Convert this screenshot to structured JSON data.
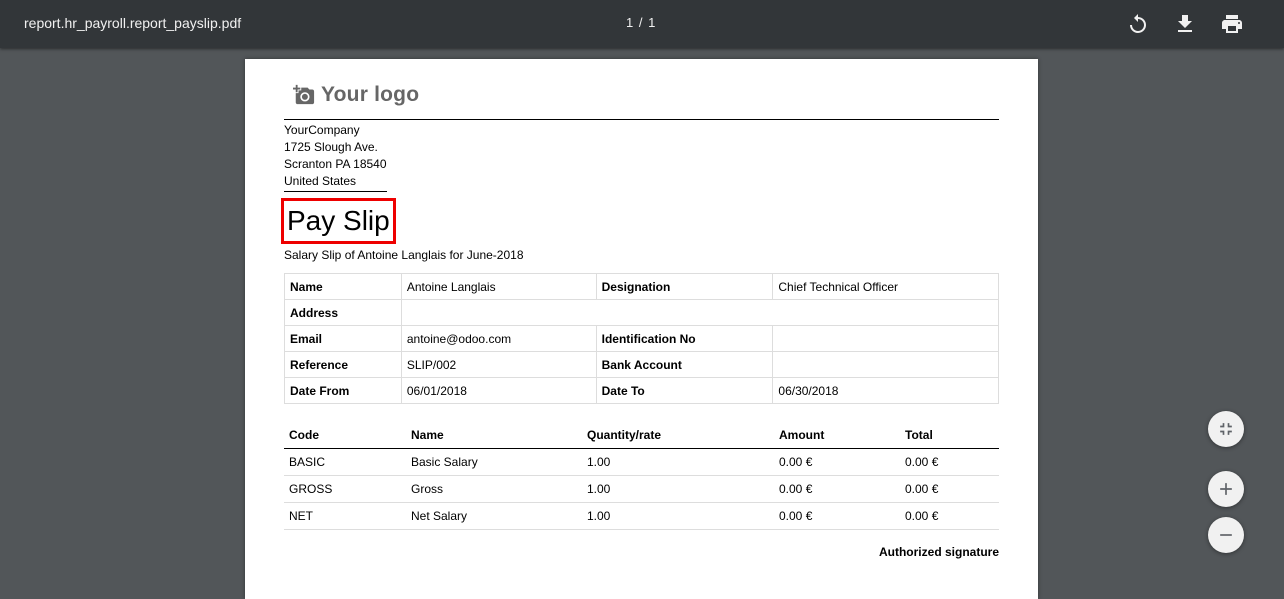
{
  "toolbar": {
    "title": "report.hr_payroll.report_payslip.pdf",
    "page_indicator": "1 / 1",
    "icons": [
      "rotate-icon",
      "download-icon",
      "print-icon"
    ]
  },
  "document": {
    "logo_text": "Your logo",
    "company": [
      "YourCompany",
      "1725 Slough Ave.",
      "Scranton PA 18540",
      "United States"
    ],
    "title": "Pay Slip",
    "subtitle": "Salary Slip of Antoine Langlais for June-2018",
    "info": {
      "name_label": "Name",
      "name_value": "Antoine Langlais",
      "designation_label": "Designation",
      "designation_value": "Chief Technical Officer",
      "address_label": "Address",
      "address_value": "",
      "email_label": "Email",
      "email_value": "antoine@odoo.com",
      "identification_label": "Identification No",
      "identification_value": "",
      "reference_label": "Reference",
      "reference_value": "SLIP/002",
      "bank_label": "Bank Account",
      "bank_value": "",
      "date_from_label": "Date From",
      "date_from_value": "06/01/2018",
      "date_to_label": "Date To",
      "date_to_value": "06/30/2018"
    },
    "lines": {
      "headers": [
        "Code",
        "Name",
        "Quantity/rate",
        "Amount",
        "Total"
      ],
      "rows": [
        [
          "BASIC",
          "Basic Salary",
          "1.00",
          "0.00 €",
          "0.00 €"
        ],
        [
          "GROSS",
          "Gross",
          "1.00",
          "0.00 €",
          "0.00 €"
        ],
        [
          "NET",
          "Net Salary",
          "1.00",
          "0.00 €",
          "0.00 €"
        ]
      ]
    },
    "signature": "Authorized signature"
  },
  "zoom_controls": [
    "fit-page-icon",
    "zoom-in-icon",
    "zoom-out-icon"
  ],
  "colors": {
    "toolbar_bg": "#323639",
    "viewer_bg": "#525659",
    "highlight_border": "#e00000"
  }
}
